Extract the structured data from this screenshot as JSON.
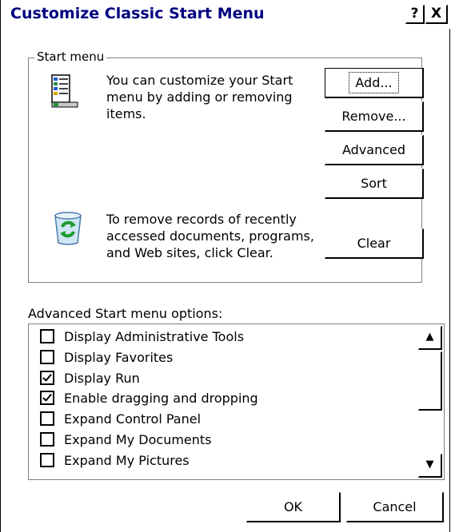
{
  "window": {
    "title": "Customize Classic Start Menu",
    "help_label": "?",
    "close_label": "X"
  },
  "start_menu": {
    "group_label": "Start menu",
    "customize_text": "You can customize your Start menu by adding or removing items.",
    "clear_text": "To remove records of recently accessed documents, programs, and Web sites, click Clear.",
    "buttons": {
      "add": "Add...",
      "remove": "Remove...",
      "advanced": "Advanced",
      "sort": "Sort",
      "clear": "Clear"
    }
  },
  "advanced": {
    "label": "Advanced Start menu options:",
    "items": [
      {
        "label": "Display Administrative Tools",
        "checked": false
      },
      {
        "label": "Display Favorites",
        "checked": false
      },
      {
        "label": "Display Run",
        "checked": true
      },
      {
        "label": "Enable dragging and dropping",
        "checked": true
      },
      {
        "label": "Expand Control Panel",
        "checked": false
      },
      {
        "label": "Expand My Documents",
        "checked": false
      },
      {
        "label": "Expand My Pictures",
        "checked": false
      }
    ]
  },
  "footer": {
    "ok": "OK",
    "cancel": "Cancel"
  },
  "icons": {
    "start_menu": "start-menu-icon",
    "recycle": "recycle-bin-icon",
    "scroll_up": "scroll-up-arrow-icon",
    "scroll_down": "scroll-down-arrow-icon"
  },
  "colors": {
    "title_text": "#000080",
    "border": "#808080"
  }
}
